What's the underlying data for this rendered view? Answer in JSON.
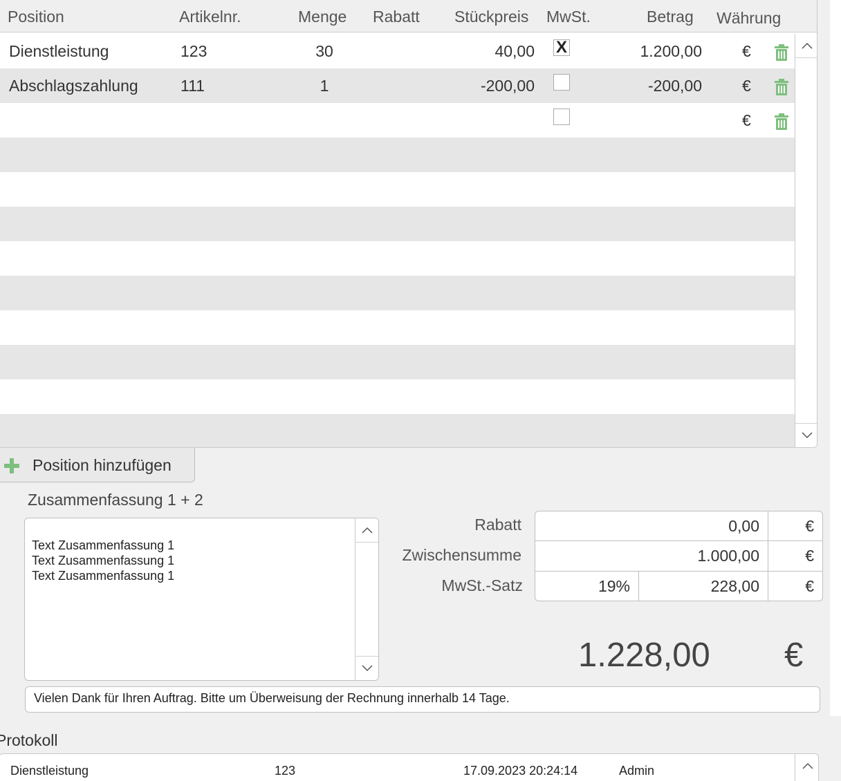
{
  "table": {
    "columns": {
      "position": "Position",
      "artikelnr": "Artikelnr.",
      "menge": "Menge",
      "rabatt": "Rabatt",
      "stueckpreis": "Stückpreis",
      "mwst": "MwSt.",
      "betrag": "Betrag",
      "waehrung": "Währung"
    },
    "rows": [
      {
        "position": "Dienstleistung",
        "artikelnr": "123",
        "menge": "30",
        "rabatt": "",
        "stueckpreis": "40,00",
        "mwst_checked": true,
        "mwst_mark": "X",
        "betrag": "1.200,00",
        "waehrung": "€"
      },
      {
        "position": "Abschlagszahlung",
        "artikelnr": "111",
        "menge": "1",
        "rabatt": "",
        "stueckpreis": "-200,00",
        "mwst_checked": false,
        "mwst_mark": "",
        "betrag": "-200,00",
        "waehrung": "€"
      },
      {
        "position": "",
        "artikelnr": "",
        "menge": "",
        "rabatt": "",
        "stueckpreis": "",
        "mwst_checked": false,
        "mwst_mark": "",
        "betrag": "",
        "waehrung": "€"
      }
    ]
  },
  "add_position_label": "Position hinzufügen",
  "summary": {
    "title": "Zusammenfassung 1 + 2",
    "text": "Text Zusammenfassung 1\nText Zusammenfassung 1\nText Zusammenfassung 1"
  },
  "totals": {
    "rabatt_label": "Rabatt",
    "rabatt_value": "0,00",
    "zwischensumme_label": "Zwischensumme",
    "zwischensumme_value": "1.000,00",
    "mwst_label": "MwSt.-Satz",
    "mwst_rate": "19%",
    "mwst_value": "228,00",
    "currency": "€",
    "grand_total": "1.228,00",
    "grand_currency": "€"
  },
  "footer_note": "Vielen Dank für Ihren Auftrag. Bitte um Überweisung der Rechnung innerhalb 14 Tage.",
  "protokoll": {
    "title": "Protokoll",
    "rows": [
      {
        "position": "Dienstleistung",
        "artikelnr": "123",
        "timestamp": "17.09.2023 20:24:14",
        "user": "Admin"
      }
    ]
  },
  "icons": {
    "trash": "trash-icon",
    "add": "plus-icon",
    "scroll_up": "chevron-up-icon",
    "scroll_down": "chevron-down-icon"
  },
  "colors": {
    "accent_green": "#7dbf7d",
    "row_alt": "#e6e6e6",
    "background": "#f0f0f0"
  }
}
